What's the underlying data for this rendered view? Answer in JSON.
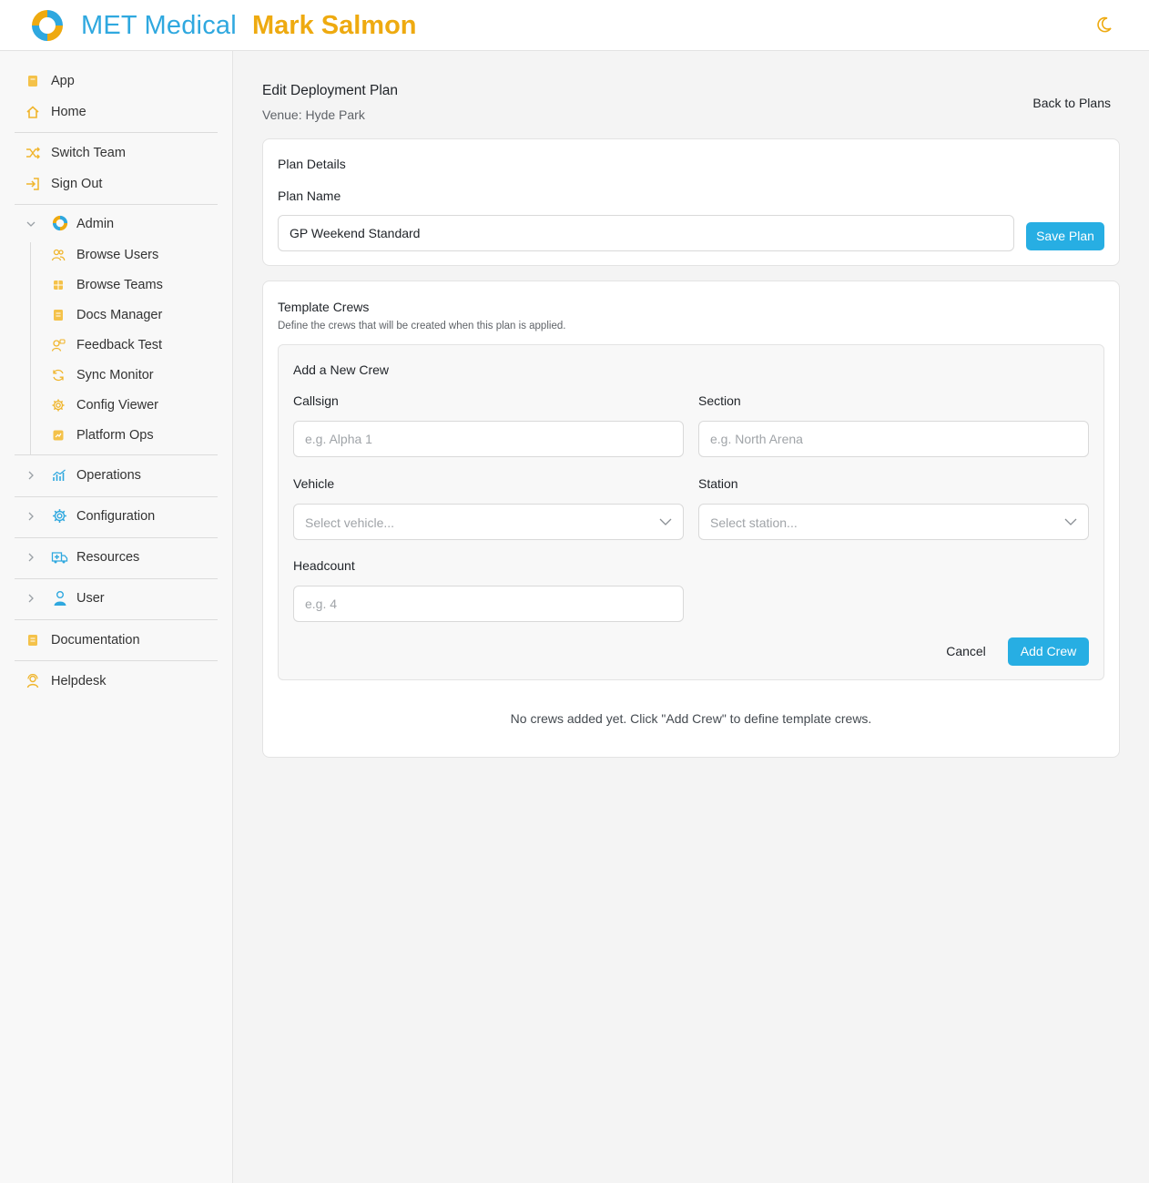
{
  "header": {
    "brand": "MET Medical",
    "user_name": "Mark Salmon",
    "theme_toggle_icon": "moon-icon",
    "colors": {
      "brand": "#2fa8df",
      "user": "#eeaa10",
      "accent": "#27aee3"
    }
  },
  "sidebar": {
    "top": [
      {
        "label": "App",
        "icon": "book-icon"
      },
      {
        "label": "Home",
        "icon": "home-icon"
      }
    ],
    "account": [
      {
        "label": "Switch Team",
        "icon": "shuffle-icon"
      },
      {
        "label": "Sign Out",
        "icon": "sign-out-icon"
      }
    ],
    "admin": {
      "label": "Admin",
      "expanded": true,
      "children": [
        {
          "label": "Browse Users",
          "icon": "users-icon"
        },
        {
          "label": "Browse Teams",
          "icon": "table-icon"
        },
        {
          "label": "Docs Manager",
          "icon": "doc-icon"
        },
        {
          "label": "Feedback Test",
          "icon": "feedback-icon"
        },
        {
          "label": "Sync Monitor",
          "icon": "sync-icon"
        },
        {
          "label": "Config Viewer",
          "icon": "gear-icon"
        },
        {
          "label": "Platform Ops",
          "icon": "ops-icon"
        }
      ]
    },
    "groups": [
      {
        "label": "Operations",
        "icon": "chart-icon"
      },
      {
        "label": "Configuration",
        "icon": "gear-icon"
      },
      {
        "label": "Resources",
        "icon": "ambulance-icon"
      },
      {
        "label": "User",
        "icon": "user-icon"
      }
    ],
    "bottom": [
      {
        "label": "Documentation",
        "icon": "book-icon"
      },
      {
        "label": "Helpdesk",
        "icon": "helpdesk-icon"
      }
    ]
  },
  "page": {
    "title": "Edit Deployment Plan",
    "venue": "Venue: Hyde Park",
    "back_label": "Back to Plans"
  },
  "plan_details": {
    "title": "Plan Details",
    "name_label": "Plan Name",
    "name_value": "GP Weekend Standard",
    "save_label": "Save Plan"
  },
  "template_crews": {
    "title": "Template Crews",
    "description": "Define the crews that will be created when this plan is applied.",
    "add_form": {
      "title": "Add a New Crew",
      "callsign_label": "Callsign",
      "callsign_placeholder": "e.g. Alpha 1",
      "section_label": "Section",
      "section_placeholder": "e.g. North Arena",
      "vehicle_label": "Vehicle",
      "vehicle_placeholder": "Select vehicle...",
      "station_label": "Station",
      "station_placeholder": "Select station...",
      "headcount_label": "Headcount",
      "headcount_placeholder": "e.g. 4",
      "cancel_label": "Cancel",
      "add_label": "Add Crew"
    },
    "empty_message": "No crews added yet. Click \"Add Crew\" to define template crews."
  }
}
